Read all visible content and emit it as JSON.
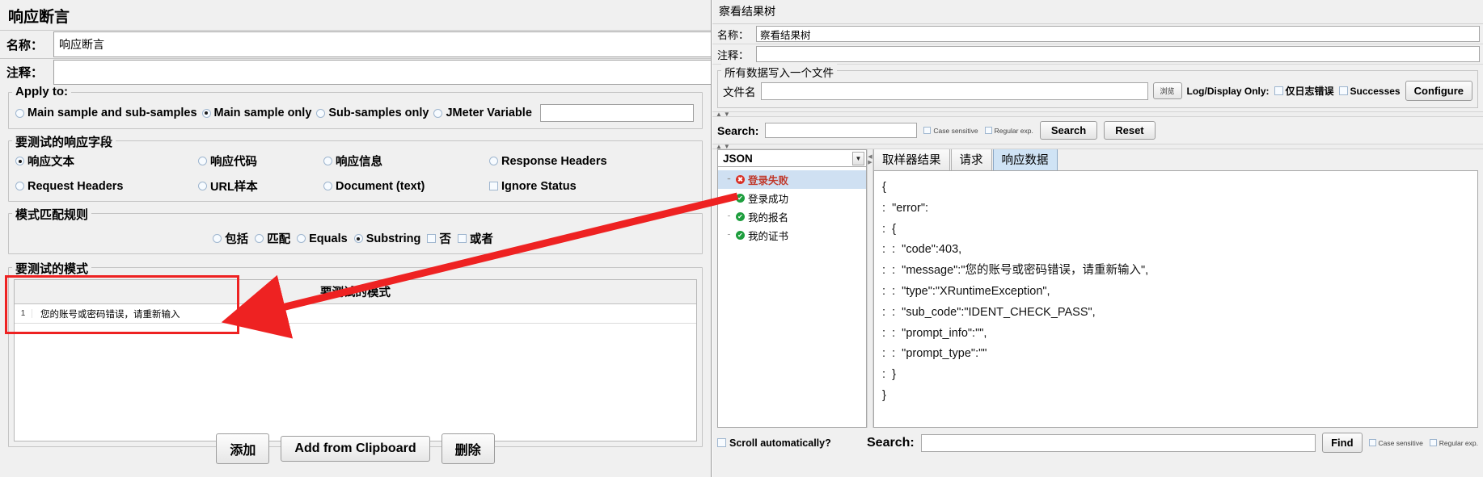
{
  "assertion": {
    "title": "响应断言",
    "name_label": "名称：",
    "name_value": "响应断言",
    "comment_label": "注释：",
    "comment_value": "",
    "apply_to": {
      "legend": "Apply to:",
      "options": [
        {
          "label": "Main sample and sub-samples",
          "selected": false
        },
        {
          "label": "Main sample only",
          "selected": true
        },
        {
          "label": "Sub-samples only",
          "selected": false
        },
        {
          "label": "JMeter Variable",
          "selected": false
        }
      ],
      "variable_value": ""
    },
    "response_field": {
      "legend": "要测试的响应字段",
      "options": [
        {
          "label": "响应文本",
          "selected": true,
          "type": "radio"
        },
        {
          "label": "响应代码",
          "selected": false,
          "type": "radio"
        },
        {
          "label": "响应信息",
          "selected": false,
          "type": "radio"
        },
        {
          "label": "Response Headers",
          "selected": false,
          "type": "radio"
        },
        {
          "label": "Request Headers",
          "selected": false,
          "type": "radio"
        },
        {
          "label": "URL样本",
          "selected": false,
          "type": "radio"
        },
        {
          "label": "Document (text)",
          "selected": false,
          "type": "radio"
        },
        {
          "label": "Ignore Status",
          "selected": false,
          "type": "checkbox"
        }
      ]
    },
    "pattern_rules": {
      "legend": "模式匹配规则",
      "options": [
        {
          "label": "包括",
          "selected": false,
          "type": "radio"
        },
        {
          "label": "匹配",
          "selected": false,
          "type": "radio"
        },
        {
          "label": "Equals",
          "selected": false,
          "type": "radio"
        },
        {
          "label": "Substring",
          "selected": true,
          "type": "radio"
        },
        {
          "label": "否",
          "selected": false,
          "type": "checkbox"
        },
        {
          "label": "或者",
          "selected": false,
          "type": "checkbox"
        }
      ]
    },
    "patterns": {
      "legend": "要测试的模式",
      "column_header": "要测试的模式",
      "rows": [
        {
          "num": "1",
          "value": "您的账号或密码错误，请重新输入"
        }
      ]
    },
    "buttons": {
      "add": "添加",
      "add_from_clipboard": "Add from Clipboard",
      "delete": "删除"
    },
    "highlight_color": "#ee2222"
  },
  "results_tree": {
    "title": "察看结果树",
    "name_label": "名称：",
    "name_value": "察看结果树",
    "comment_label": "注释：",
    "comment_value": "",
    "file_group": {
      "legend": "所有数据写入一个文件",
      "filename_label": "文件名",
      "filename_value": "",
      "browse_label": "浏览",
      "log_display_label": "Log/Display Only:",
      "errors_label": "仅日志错误",
      "errors_checked": false,
      "successes_label": "Successes",
      "successes_checked": false,
      "configure_label": "Configure"
    },
    "search": {
      "label": "Search:",
      "value": "",
      "case_sensitive_label": "Case sensitive",
      "case_sensitive_checked": false,
      "regular_exp_label": "Regular exp.",
      "regular_exp_checked": false,
      "search_button": "Search",
      "reset_button": "Reset"
    },
    "renderer": {
      "selected": "JSON"
    },
    "tree_items": [
      {
        "label": "登录失败",
        "status": "fail",
        "selected": true
      },
      {
        "label": "登录成功",
        "status": "ok",
        "selected": false
      },
      {
        "label": "我的报名",
        "status": "ok",
        "selected": false
      },
      {
        "label": "我的证书",
        "status": "ok",
        "selected": false
      }
    ],
    "tabs": [
      {
        "label": "取样器结果",
        "active": false
      },
      {
        "label": "请求",
        "active": false
      },
      {
        "label": "响应数据",
        "active": true
      }
    ],
    "response_lines": [
      "{",
      ":  \"error\":",
      ":  {",
      ":  :  \"code\":403,",
      ":  :  \"message\":\"您的账号或密码错误，请重新输入\",",
      ":  :  \"type\":\"XRuntimeException\",",
      ":  :  \"sub_code\":\"IDENT_CHECK_PASS\",",
      ":  :  \"prompt_info\":\"\",",
      ":  :  \"prompt_type\":\"\"",
      ":  }",
      "}"
    ],
    "bottom_search": {
      "label": "Search:",
      "value": "",
      "find_button": "Find",
      "case_sensitive_label": "Case sensitive",
      "regular_exp_label": "Regular exp."
    },
    "scroll_automatically": {
      "label": "Scroll automatically?",
      "checked": false
    }
  }
}
